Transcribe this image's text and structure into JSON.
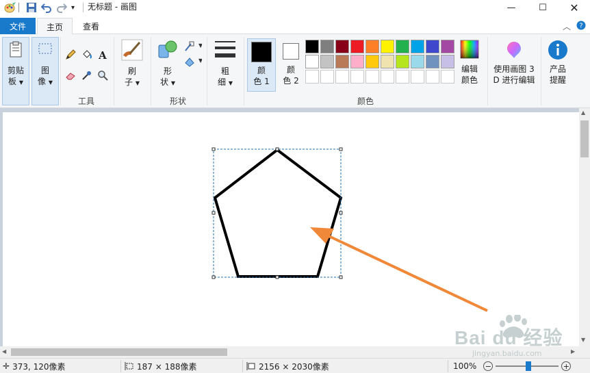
{
  "title_bar": {
    "title": "无标题 - 画图"
  },
  "tabs": {
    "file": "文件",
    "home": "主页",
    "view": "查看"
  },
  "ribbon": {
    "clipboard": "剪贴板",
    "clipboard_l1": "剪贴",
    "clipboard_l2": "板",
    "image_l1": "图",
    "image_l2": "像",
    "tools_label": "工具",
    "brush_l1": "刷",
    "brush_l2": "子",
    "shapes_l1": "形",
    "shapes_l2": "状",
    "shapes_label": "形状",
    "size_l1": "粗",
    "size_l2": "细",
    "color1_l1": "颜",
    "color1_l2": "色 1",
    "color2_l1": "颜",
    "color2_l2": "色 2",
    "colors_label": "颜色",
    "edit_colors_l1": "编辑",
    "edit_colors_l2": "颜色",
    "paint3d_l1": "使用画图 3",
    "paint3d_l2": "D 进行编辑",
    "tips_l1": "产品",
    "tips_l2": "提醒"
  },
  "palette_row1": [
    "#000000",
    "#7f7f7f",
    "#880015",
    "#ed1c24",
    "#ff7f27",
    "#fff200",
    "#22b14c",
    "#00a2e8",
    "#3f48cc",
    "#a349a4"
  ],
  "palette_row2": [
    "#ffffff",
    "#c3c3c3",
    "#b97a57",
    "#ffaec9",
    "#ffc90e",
    "#efe4b0",
    "#b5e61d",
    "#99d9ea",
    "#7092be",
    "#c8bfe7"
  ],
  "status": {
    "cursor": "373, 120像素",
    "selection": "187 × 188像素",
    "canvas_size": "2156 × 2030像素",
    "zoom": "100%"
  },
  "watermark": {
    "brand": "Bai du 经验",
    "url": "jingyan.baidu.com"
  },
  "colors": {
    "accent": "#1979ca",
    "arrow": "#f0883a"
  }
}
